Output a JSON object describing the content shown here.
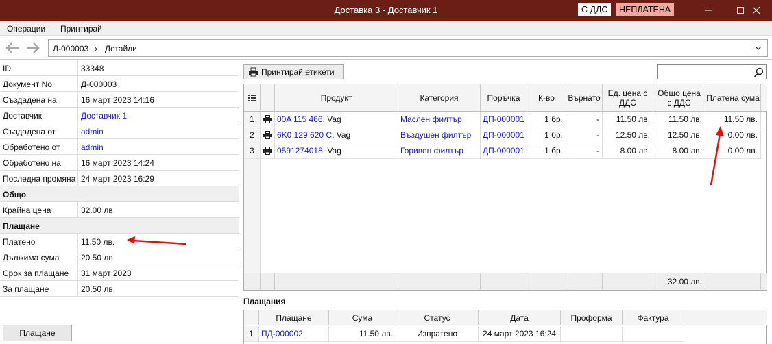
{
  "window": {
    "title": "Доставка 3 - Доставчик 1",
    "vat_badge": "С ДДС",
    "status_badge": "НЕПЛАТЕНА"
  },
  "menu": {
    "operations": "Операции",
    "print": "Принтирай"
  },
  "nav": {
    "doc": "Д-000003",
    "sep": "›",
    "page": "Детайли"
  },
  "props": {
    "id": {
      "k": "ID",
      "v": "33348"
    },
    "doc_no": {
      "k": "Документ No",
      "v": "Д-000003"
    },
    "created_on": {
      "k": "Създадена на",
      "v": "16 март 2023 14:16"
    },
    "supplier": {
      "k": "Доставчик",
      "v": "Доставчик 1"
    },
    "created_by": {
      "k": "Създадена от",
      "v": "admin"
    },
    "processed_by": {
      "k": "Обработено от",
      "v": "admin"
    },
    "processed_on": {
      "k": "Обработено на",
      "v": "16 март 2023 14:24"
    },
    "last_change": {
      "k": "Последна промяна",
      "v": "24 март 2023 16:29"
    },
    "total_head": "Общо",
    "final_price": {
      "k": "Крайна цена",
      "v": "32.00 лв."
    },
    "payment_head": "Плащане",
    "paid": {
      "k": "Платено",
      "v": "11.50 лв."
    },
    "due": {
      "k": "Дължима сума",
      "v": "20.50 лв."
    },
    "deadline": {
      "k": "Срок за плащане",
      "v": "31 март 2023"
    },
    "to_pay": {
      "k": "За плащане",
      "v": "20.50 лв."
    }
  },
  "pay_button": "Плащане",
  "print_labels_button": "Принтирай етикети",
  "grid": {
    "headers": {
      "product": "Продукт",
      "category": "Категория",
      "order": "Поръчка",
      "qty": "К-во",
      "returned": "Върнато",
      "unit_price": "Ед. цена с ДДС",
      "total": "Общо цена с ДДС",
      "paid": "Платена сума"
    },
    "rows": [
      {
        "n": "1",
        "code": "00A 115 466",
        "brand": ", Vag",
        "category": "Маслен филтър",
        "order": "ДП-000001",
        "qty": "1 бр.",
        "returned": "-",
        "unit_price": "11.50 лв.",
        "total": "11.50 лв.",
        "paid": "11.50 лв."
      },
      {
        "n": "2",
        "code": "6K0 129 620 C",
        "brand": ", Vag",
        "category": "Въздушен филтър",
        "order": "ДП-000001",
        "qty": "1 бр.",
        "returned": "-",
        "unit_price": "12.50 лв.",
        "total": "12.50 лв.",
        "paid": "0.00 лв."
      },
      {
        "n": "3",
        "code": "0591274018",
        "brand": ", Vag",
        "category": "Горивен филтър",
        "order": "ДП-000001",
        "qty": "1 бр.",
        "returned": "-",
        "unit_price": "8.00 лв.",
        "total": "8.00 лв.",
        "paid": "0.00 лв."
      }
    ],
    "footer_total": "32.00 лв."
  },
  "payments": {
    "title": "Плащания",
    "headers": {
      "payment": "Плащане",
      "amount": "Сума",
      "status": "Статус",
      "date": "Дата",
      "proforma": "Проформа",
      "invoice": "Фактура"
    },
    "rows": [
      {
        "n": "1",
        "payment": "ПД-000002",
        "amount": "11.50 лв.",
        "status": "Изпратено",
        "date": "24 март 2023 16:24",
        "proforma": "",
        "invoice": ""
      }
    ]
  },
  "colors": {
    "titlebar": "#6b1e16",
    "unpaid_badge": "#f4a79c",
    "link": "#1a1ad0",
    "annotation": "#e01010"
  }
}
